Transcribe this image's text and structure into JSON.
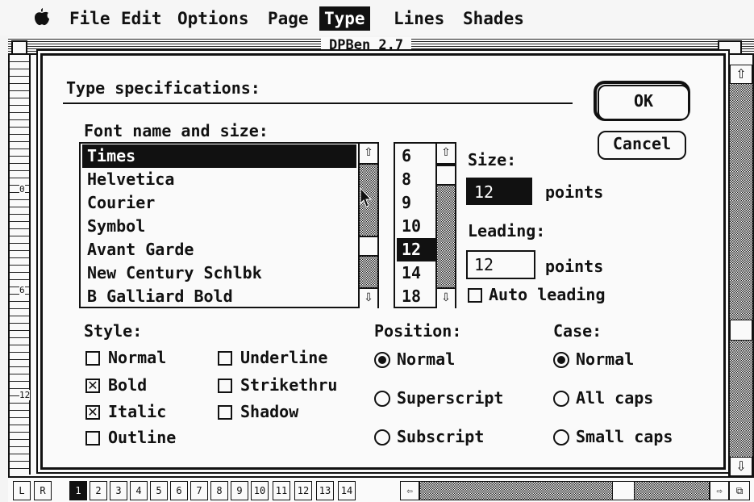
{
  "menubar": {
    "apple": "",
    "items": [
      "File",
      "Edit",
      "Options",
      "Page",
      "Type",
      "Lines",
      "Shades"
    ],
    "selected": "Type"
  },
  "window": {
    "title": "DPBen 2.7",
    "ruler_numbers": [
      "0",
      "6",
      "12"
    ]
  },
  "dialog": {
    "heading": "Type specifications:",
    "ok_label": "OK",
    "cancel_label": "Cancel",
    "font_label": "Font name and size:",
    "fonts": [
      "Times",
      "Helvetica",
      "Courier",
      "Symbol",
      "Avant Garde",
      "New Century Schlbk",
      "B Galliard Bold"
    ],
    "selected_font": "Times",
    "sizes": [
      "6",
      "8",
      "9",
      "10",
      "12",
      "14",
      "18"
    ],
    "selected_size": "12",
    "size_label": "Size:",
    "size_value": "12",
    "size_unit": "points",
    "leading_label": "Leading:",
    "leading_value": "12",
    "leading_unit": "points",
    "auto_leading_label": "Auto leading",
    "auto_leading_checked": false,
    "style_label": "Style:",
    "styles": [
      {
        "label": "Normal",
        "checked": false
      },
      {
        "label": "Bold",
        "checked": true
      },
      {
        "label": "Italic",
        "checked": true
      },
      {
        "label": "Outline",
        "checked": false
      },
      {
        "label": "Underline",
        "checked": false
      },
      {
        "label": "Strikethru",
        "checked": false
      },
      {
        "label": "Shadow",
        "checked": false
      }
    ],
    "position_label": "Position:",
    "positions": [
      "Normal",
      "Superscript",
      "Subscript"
    ],
    "position_selected": "Normal",
    "case_label": "Case:",
    "cases": [
      "Normal",
      "All caps",
      "Small caps"
    ],
    "case_selected": "Normal"
  },
  "bottombar": {
    "left_right": [
      "L",
      "R"
    ],
    "pages": [
      "1",
      "2",
      "3",
      "4",
      "5",
      "6",
      "7",
      "8",
      "9",
      "10",
      "11",
      "12",
      "13",
      "14"
    ],
    "current_page": "1"
  },
  "icons": {
    "up_arrow": "⇧",
    "down_arrow": "⇩",
    "left_arrow": "⇦",
    "right_arrow": "⇨",
    "checkbox_checked": "☒",
    "pointer": "arrow-cursor-icon"
  }
}
